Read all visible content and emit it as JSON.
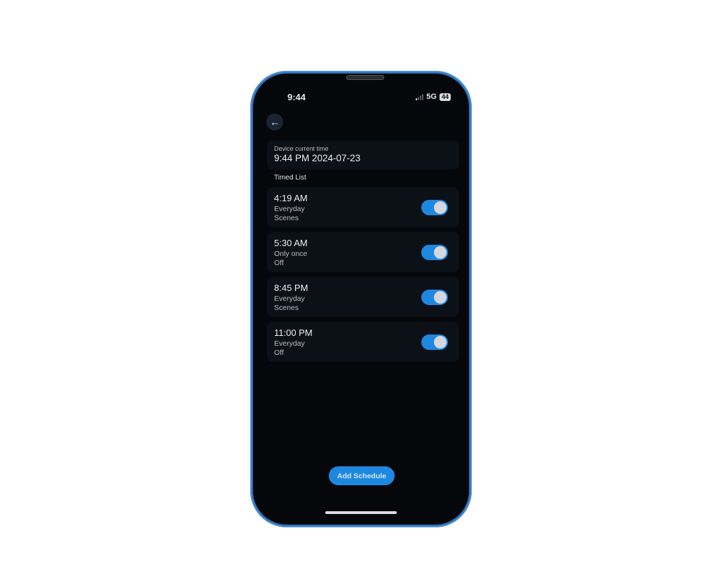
{
  "status_bar": {
    "time": "9:44",
    "network": "5G",
    "battery": "44"
  },
  "header": {
    "back_icon": "arrow-left-icon"
  },
  "device_time": {
    "label": "Device current time",
    "value": "9:44 PM 2024-07-23"
  },
  "timed_list": {
    "title": "Timed List",
    "items": [
      {
        "time": "4:19 AM",
        "repeat": "Everyday",
        "action": "Scenes",
        "enabled": true
      },
      {
        "time": "5:30 AM",
        "repeat": "Only once",
        "action": "Off",
        "enabled": true
      },
      {
        "time": "8:45 PM",
        "repeat": "Everyday",
        "action": "Scenes",
        "enabled": true
      },
      {
        "time": "11:00 PM",
        "repeat": "Everyday",
        "action": "Off",
        "enabled": true
      }
    ]
  },
  "footer": {
    "add_button_label": "Add Schedule"
  },
  "colors": {
    "accent": "#1e88e0",
    "background": "#05070b",
    "card": "#0c1017"
  }
}
